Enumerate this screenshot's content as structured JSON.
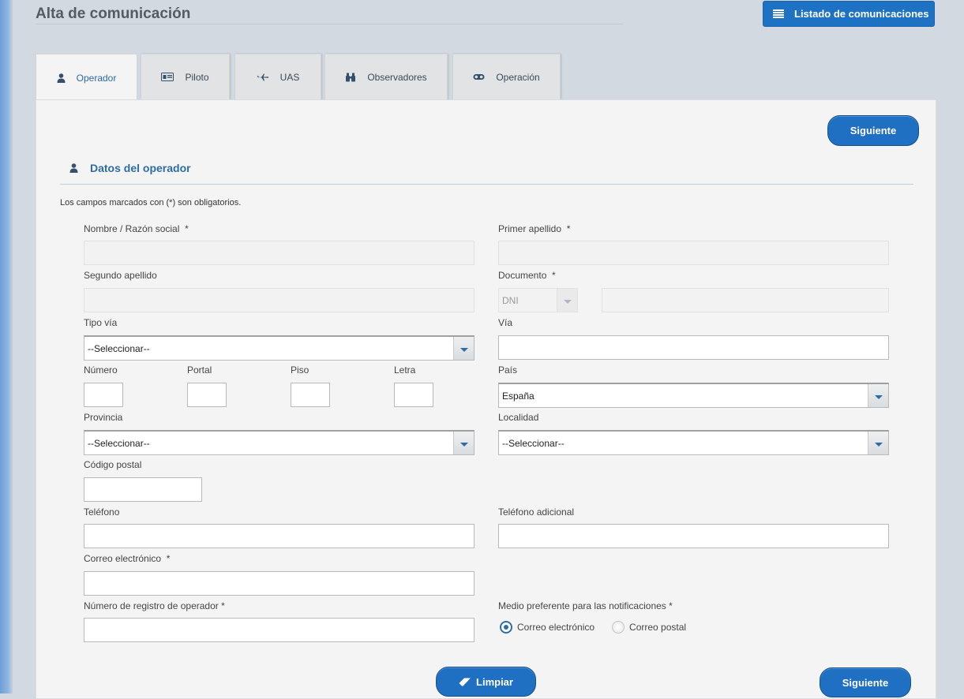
{
  "header": {
    "title": "Alta de comunicación",
    "list_button_label": "Listado de comunicaciones"
  },
  "tabs": [
    {
      "label": "Operador",
      "icon": "user-icon",
      "active": true
    },
    {
      "label": "Piloto",
      "icon": "id-card-icon",
      "active": false
    },
    {
      "label": "UAS",
      "icon": "aircraft-icon",
      "active": false
    },
    {
      "label": "Observadores",
      "icon": "binoculars-icon",
      "active": false
    },
    {
      "label": "Operación",
      "icon": "goggles-icon",
      "active": false
    }
  ],
  "form": {
    "next_label": "Siguiente",
    "section_title": "Datos del operador",
    "required_note": "Los campos marcados con (*) son obligatorios.",
    "fields": {
      "nombre": {
        "label": "Nombre / Razón social",
        "required": "*",
        "value": ""
      },
      "primer_apellido": {
        "label": "Primer apellido",
        "required": "*",
        "value": ""
      },
      "segundo_apellido": {
        "label": "Segundo apellido",
        "value": ""
      },
      "documento": {
        "label": "Documento",
        "required": "*",
        "type_value": "DNI",
        "value": ""
      },
      "tipo_via": {
        "label": "Tipo vía",
        "value": "--Seleccionar--"
      },
      "via": {
        "label": "Vía",
        "value": ""
      },
      "numero": {
        "label": "Número",
        "value": ""
      },
      "portal": {
        "label": "Portal",
        "value": ""
      },
      "piso": {
        "label": "Piso",
        "value": ""
      },
      "letra": {
        "label": "Letra",
        "value": ""
      },
      "pais": {
        "label": "País",
        "value": "España"
      },
      "provincia": {
        "label": "Provincia",
        "value": "--Seleccionar--"
      },
      "localidad": {
        "label": "Localidad",
        "value": "--Seleccionar--"
      },
      "codigo_postal": {
        "label": "Código postal",
        "value": ""
      },
      "telefono": {
        "label": "Teléfono",
        "value": ""
      },
      "telefono_adicional": {
        "label": "Teléfono adicional",
        "value": ""
      },
      "correo": {
        "label": "Correo electrónico",
        "required": "*",
        "value": ""
      },
      "registro": {
        "label": "Número de registro de operador",
        "required": "*",
        "value": ""
      },
      "medio": {
        "label": "Medio preferente para las notificaciones",
        "required": "*",
        "options": [
          "Correo electrónico",
          "Correo postal"
        ],
        "selected": "Correo electrónico"
      }
    },
    "clear_label": "Limpiar"
  },
  "colors": {
    "accent": "#1f6fc2",
    "label_blue": "#2e6da4",
    "background": "#d2d9e1",
    "panel": "#f4f4f4"
  }
}
